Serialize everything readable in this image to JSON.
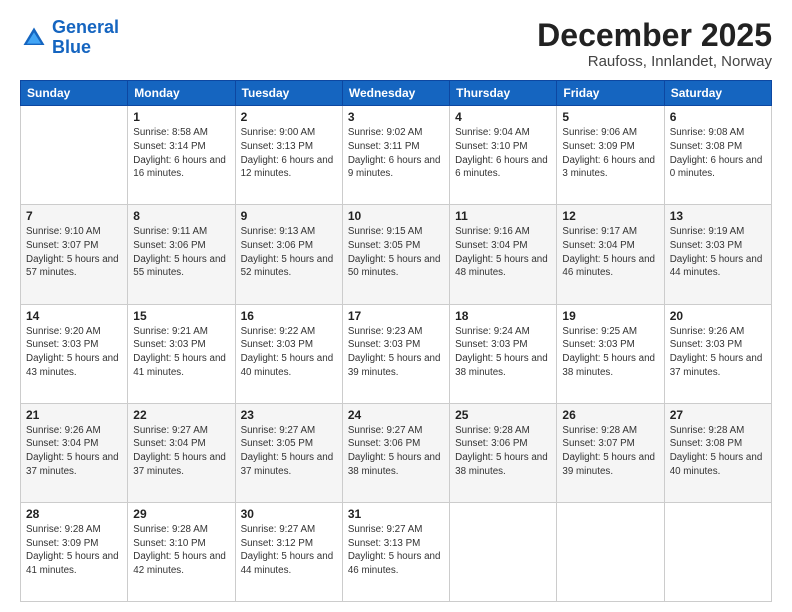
{
  "logo": {
    "line1": "General",
    "line2": "Blue"
  },
  "header": {
    "month": "December 2025",
    "location": "Raufoss, Innlandet, Norway"
  },
  "days_of_week": [
    "Sunday",
    "Monday",
    "Tuesday",
    "Wednesday",
    "Thursday",
    "Friday",
    "Saturday"
  ],
  "weeks": [
    [
      {
        "num": "",
        "sunrise": "",
        "sunset": "",
        "daylight": ""
      },
      {
        "num": "1",
        "sunrise": "Sunrise: 8:58 AM",
        "sunset": "Sunset: 3:14 PM",
        "daylight": "Daylight: 6 hours and 16 minutes."
      },
      {
        "num": "2",
        "sunrise": "Sunrise: 9:00 AM",
        "sunset": "Sunset: 3:13 PM",
        "daylight": "Daylight: 6 hours and 12 minutes."
      },
      {
        "num": "3",
        "sunrise": "Sunrise: 9:02 AM",
        "sunset": "Sunset: 3:11 PM",
        "daylight": "Daylight: 6 hours and 9 minutes."
      },
      {
        "num": "4",
        "sunrise": "Sunrise: 9:04 AM",
        "sunset": "Sunset: 3:10 PM",
        "daylight": "Daylight: 6 hours and 6 minutes."
      },
      {
        "num": "5",
        "sunrise": "Sunrise: 9:06 AM",
        "sunset": "Sunset: 3:09 PM",
        "daylight": "Daylight: 6 hours and 3 minutes."
      },
      {
        "num": "6",
        "sunrise": "Sunrise: 9:08 AM",
        "sunset": "Sunset: 3:08 PM",
        "daylight": "Daylight: 6 hours and 0 minutes."
      }
    ],
    [
      {
        "num": "7",
        "sunrise": "Sunrise: 9:10 AM",
        "sunset": "Sunset: 3:07 PM",
        "daylight": "Daylight: 5 hours and 57 minutes."
      },
      {
        "num": "8",
        "sunrise": "Sunrise: 9:11 AM",
        "sunset": "Sunset: 3:06 PM",
        "daylight": "Daylight: 5 hours and 55 minutes."
      },
      {
        "num": "9",
        "sunrise": "Sunrise: 9:13 AM",
        "sunset": "Sunset: 3:06 PM",
        "daylight": "Daylight: 5 hours and 52 minutes."
      },
      {
        "num": "10",
        "sunrise": "Sunrise: 9:15 AM",
        "sunset": "Sunset: 3:05 PM",
        "daylight": "Daylight: 5 hours and 50 minutes."
      },
      {
        "num": "11",
        "sunrise": "Sunrise: 9:16 AM",
        "sunset": "Sunset: 3:04 PM",
        "daylight": "Daylight: 5 hours and 48 minutes."
      },
      {
        "num": "12",
        "sunrise": "Sunrise: 9:17 AM",
        "sunset": "Sunset: 3:04 PM",
        "daylight": "Daylight: 5 hours and 46 minutes."
      },
      {
        "num": "13",
        "sunrise": "Sunrise: 9:19 AM",
        "sunset": "Sunset: 3:03 PM",
        "daylight": "Daylight: 5 hours and 44 minutes."
      }
    ],
    [
      {
        "num": "14",
        "sunrise": "Sunrise: 9:20 AM",
        "sunset": "Sunset: 3:03 PM",
        "daylight": "Daylight: 5 hours and 43 minutes."
      },
      {
        "num": "15",
        "sunrise": "Sunrise: 9:21 AM",
        "sunset": "Sunset: 3:03 PM",
        "daylight": "Daylight: 5 hours and 41 minutes."
      },
      {
        "num": "16",
        "sunrise": "Sunrise: 9:22 AM",
        "sunset": "Sunset: 3:03 PM",
        "daylight": "Daylight: 5 hours and 40 minutes."
      },
      {
        "num": "17",
        "sunrise": "Sunrise: 9:23 AM",
        "sunset": "Sunset: 3:03 PM",
        "daylight": "Daylight: 5 hours and 39 minutes."
      },
      {
        "num": "18",
        "sunrise": "Sunrise: 9:24 AM",
        "sunset": "Sunset: 3:03 PM",
        "daylight": "Daylight: 5 hours and 38 minutes."
      },
      {
        "num": "19",
        "sunrise": "Sunrise: 9:25 AM",
        "sunset": "Sunset: 3:03 PM",
        "daylight": "Daylight: 5 hours and 38 minutes."
      },
      {
        "num": "20",
        "sunrise": "Sunrise: 9:26 AM",
        "sunset": "Sunset: 3:03 PM",
        "daylight": "Daylight: 5 hours and 37 minutes."
      }
    ],
    [
      {
        "num": "21",
        "sunrise": "Sunrise: 9:26 AM",
        "sunset": "Sunset: 3:04 PM",
        "daylight": "Daylight: 5 hours and 37 minutes."
      },
      {
        "num": "22",
        "sunrise": "Sunrise: 9:27 AM",
        "sunset": "Sunset: 3:04 PM",
        "daylight": "Daylight: 5 hours and 37 minutes."
      },
      {
        "num": "23",
        "sunrise": "Sunrise: 9:27 AM",
        "sunset": "Sunset: 3:05 PM",
        "daylight": "Daylight: 5 hours and 37 minutes."
      },
      {
        "num": "24",
        "sunrise": "Sunrise: 9:27 AM",
        "sunset": "Sunset: 3:06 PM",
        "daylight": "Daylight: 5 hours and 38 minutes."
      },
      {
        "num": "25",
        "sunrise": "Sunrise: 9:28 AM",
        "sunset": "Sunset: 3:06 PM",
        "daylight": "Daylight: 5 hours and 38 minutes."
      },
      {
        "num": "26",
        "sunrise": "Sunrise: 9:28 AM",
        "sunset": "Sunset: 3:07 PM",
        "daylight": "Daylight: 5 hours and 39 minutes."
      },
      {
        "num": "27",
        "sunrise": "Sunrise: 9:28 AM",
        "sunset": "Sunset: 3:08 PM",
        "daylight": "Daylight: 5 hours and 40 minutes."
      }
    ],
    [
      {
        "num": "28",
        "sunrise": "Sunrise: 9:28 AM",
        "sunset": "Sunset: 3:09 PM",
        "daylight": "Daylight: 5 hours and 41 minutes."
      },
      {
        "num": "29",
        "sunrise": "Sunrise: 9:28 AM",
        "sunset": "Sunset: 3:10 PM",
        "daylight": "Daylight: 5 hours and 42 minutes."
      },
      {
        "num": "30",
        "sunrise": "Sunrise: 9:27 AM",
        "sunset": "Sunset: 3:12 PM",
        "daylight": "Daylight: 5 hours and 44 minutes."
      },
      {
        "num": "31",
        "sunrise": "Sunrise: 9:27 AM",
        "sunset": "Sunset: 3:13 PM",
        "daylight": "Daylight: 5 hours and 46 minutes."
      },
      {
        "num": "",
        "sunrise": "",
        "sunset": "",
        "daylight": ""
      },
      {
        "num": "",
        "sunrise": "",
        "sunset": "",
        "daylight": ""
      },
      {
        "num": "",
        "sunrise": "",
        "sunset": "",
        "daylight": ""
      }
    ]
  ]
}
